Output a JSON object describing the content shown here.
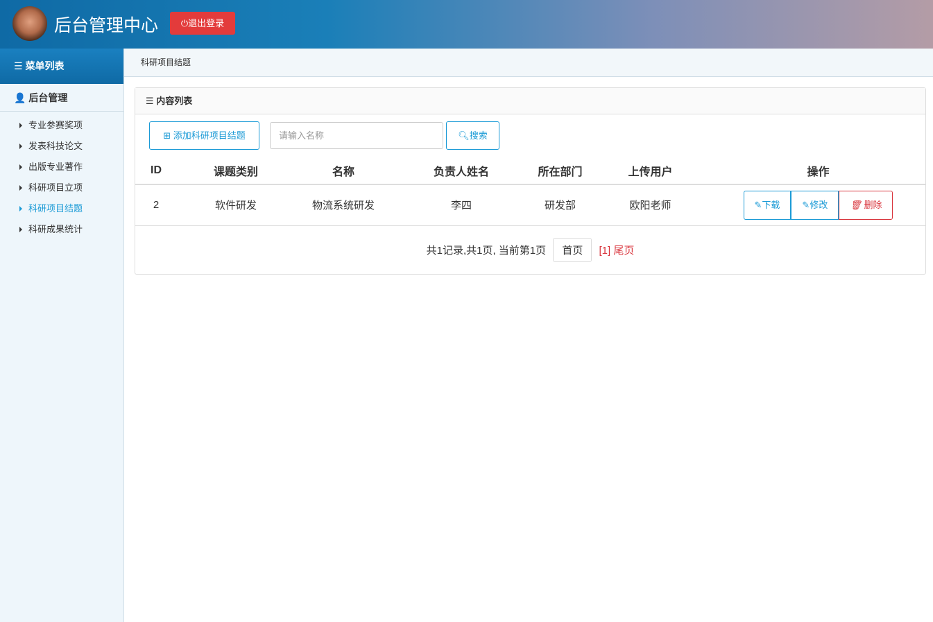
{
  "header": {
    "title": "后台管理中心",
    "logout": "退出登录"
  },
  "sidebar": {
    "menu_title": "菜单列表",
    "group": "后台管理",
    "items": [
      {
        "label": "专业参赛奖项"
      },
      {
        "label": "发表科技论文"
      },
      {
        "label": "出版专业著作"
      },
      {
        "label": "科研项目立项"
      },
      {
        "label": "科研项目结题",
        "active": true
      },
      {
        "label": "科研成果统计"
      }
    ]
  },
  "breadcrumb": "科研项目结题",
  "panel": {
    "title": "内容列表",
    "add_button": "添加科研项目结题",
    "search_placeholder": "请输入名称",
    "search_button": "搜索"
  },
  "table": {
    "columns": [
      "ID",
      "课题类别",
      "名称",
      "负责人姓名",
      "所在部门",
      "上传用户",
      "操作"
    ],
    "rows": [
      {
        "id": "2",
        "category": "软件研发",
        "name": "物流系统研发",
        "leader": "李四",
        "dept": "研发部",
        "uploader": "欧阳老师"
      }
    ],
    "actions": {
      "download": "下载",
      "edit": "修改",
      "delete": "删除"
    }
  },
  "pager": {
    "summary": "共1记录,共1页, 当前第1页",
    "first": "首页",
    "current": "[1]",
    "last": "尾页"
  }
}
